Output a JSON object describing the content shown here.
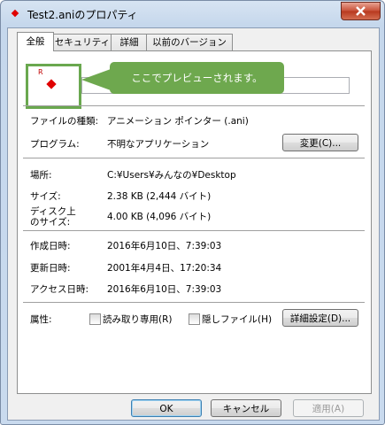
{
  "window": {
    "title": "Test2.aniのプロパティ"
  },
  "tabs": [
    {
      "label": "全般"
    },
    {
      "label": "セキュリティ"
    },
    {
      "label": "詳細"
    },
    {
      "label": "以前のバージョン"
    }
  ],
  "preview": {
    "caption": "R",
    "callout": "ここでプレビューされます。"
  },
  "file_type": {
    "label": "ファイルの種類:",
    "value": "アニメーション ポインター (.ani)"
  },
  "program": {
    "label": "プログラム:",
    "value": "不明なアプリケーション",
    "change_button": "変更(C)..."
  },
  "location": {
    "label": "場所:",
    "value": "C:¥Users¥みんなの¥Desktop"
  },
  "size": {
    "label": "サイズ:",
    "value": "2.38 KB (2,444 バイト)"
  },
  "disk_size": {
    "label_line1": "ディスク上",
    "label_line2": "のサイズ:",
    "value": "4.00 KB (4,096 バイト)"
  },
  "created": {
    "label": "作成日時:",
    "value": "2016年6月10日、7:39:03"
  },
  "modified": {
    "label": "更新日時:",
    "value": "2001年4月4日、17:20:34"
  },
  "accessed": {
    "label": "アクセス日時:",
    "value": "2016年6月10日、7:39:03"
  },
  "attributes": {
    "label": "属性:",
    "readonly": "読み取り専用(R)",
    "hidden": "隠しファイル(H)",
    "advanced_button": "詳細設定(D)..."
  },
  "buttons": {
    "ok": "OK",
    "cancel": "キャンセル",
    "apply": "適用(A)"
  },
  "colors": {
    "accent_green": "#6ea84e",
    "cursor_red": "#e00000"
  }
}
